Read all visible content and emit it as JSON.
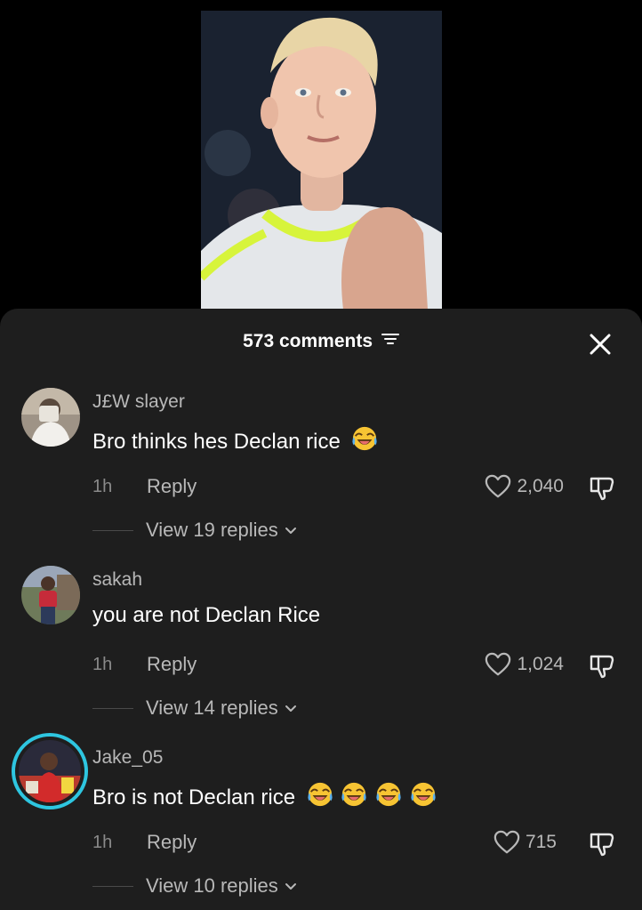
{
  "video": {
    "thumbnail_icon": "player-photo"
  },
  "header": {
    "comment_count": "573 comments",
    "filter_icon": "filter-lines-icon",
    "close_icon": "close-icon"
  },
  "comments": [
    {
      "username": "J£W slayer",
      "text": "Bro thinks hes Declan rice",
      "emoji_count": 1,
      "time": "1h",
      "reply_label": "Reply",
      "likes": "2,040",
      "view_replies": "View 19 replies"
    },
    {
      "username": "sakah",
      "text": "you are not Declan Rice",
      "emoji_count": 0,
      "time": "1h",
      "reply_label": "Reply",
      "likes": "1,024",
      "view_replies": "View 14 replies"
    },
    {
      "username": "Jake_05",
      "text": "Bro is not Declan rice",
      "emoji_count": 4,
      "time": "1h",
      "reply_label": "Reply",
      "likes": "715",
      "view_replies": "View 10 replies"
    }
  ],
  "colors": {
    "sheet_bg": "#1e1e1e",
    "story_ring": "#2ec6e0",
    "muted_text": "#b8b8b8",
    "primary_text": "#ffffff"
  }
}
